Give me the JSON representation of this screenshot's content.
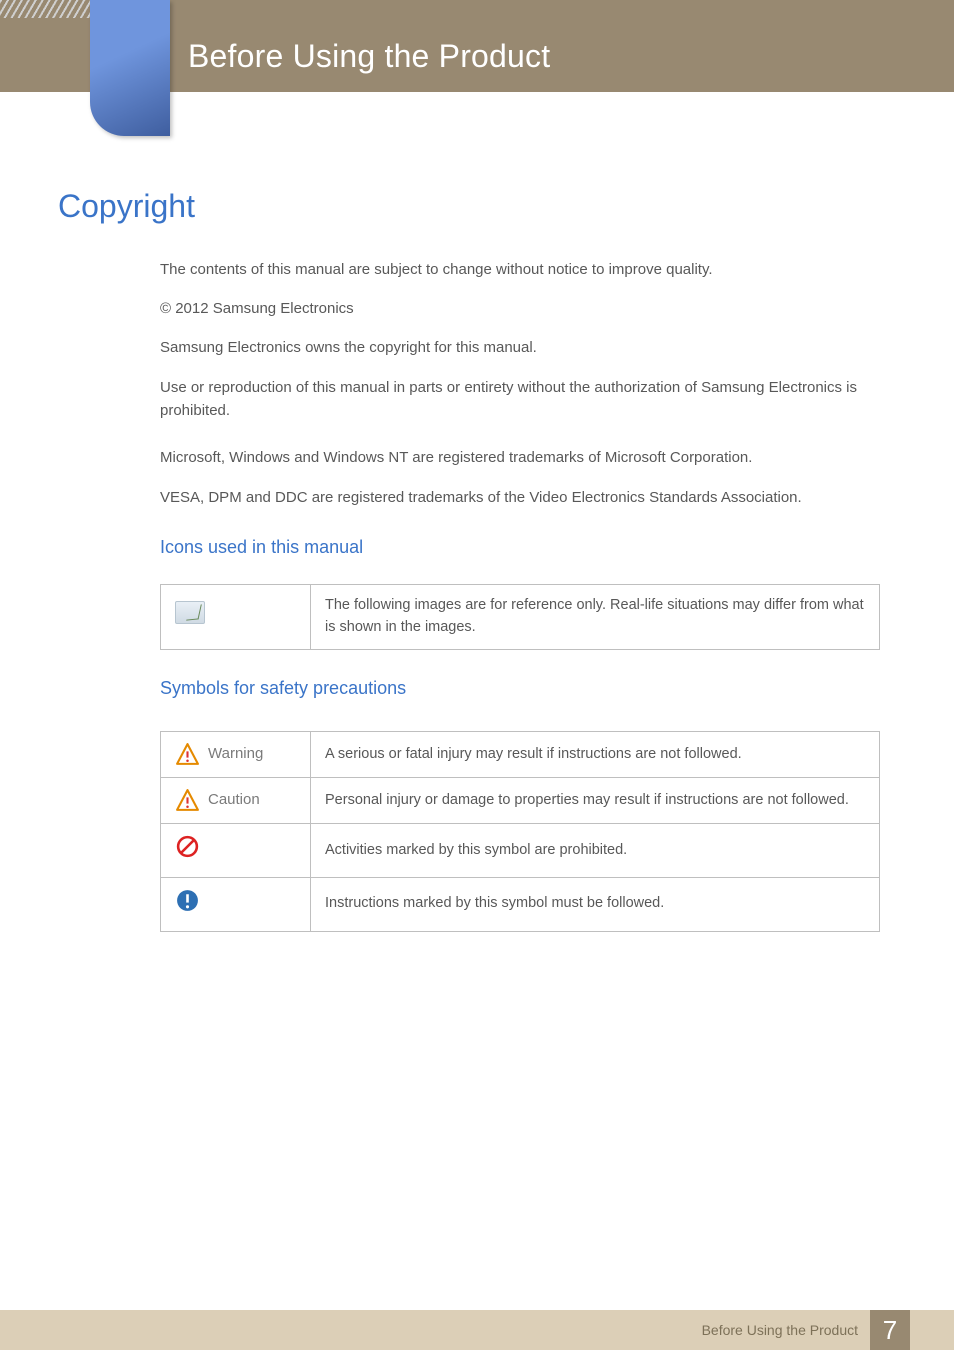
{
  "header": {
    "title": "Before Using the Product"
  },
  "sections": {
    "copyright_heading": "Copyright",
    "paragraphs": {
      "p1": "The contents of this manual are subject to change without notice to improve quality.",
      "p2": "© 2012 Samsung Electronics",
      "p3": "Samsung Electronics owns the copyright for this manual.",
      "p4": "Use or reproduction of this manual in parts or entirety without the authorization of Samsung Electronics is prohibited.",
      "p5": "Microsoft, Windows and Windows NT are registered trademarks of Microsoft Corporation.",
      "p6": "VESA, DPM and DDC are registered trademarks of the Video Electronics Standards Association."
    },
    "icons_heading": "Icons used in this manual",
    "icons_table": {
      "row1_desc": "The following images are for reference only. Real-life situations may differ from what is shown in the images."
    },
    "symbols_heading": "Symbols for safety precautions",
    "symbols_table": {
      "warning_label": "Warning",
      "warning_desc": "A serious or fatal injury may result if instructions are not followed.",
      "caution_label": "Caution",
      "caution_desc": "Personal injury or damage to properties may result if instructions are not followed.",
      "prohibited_desc": "Activities marked by this symbol are prohibited.",
      "mustfollow_desc": "Instructions marked by this symbol must be followed."
    }
  },
  "footer": {
    "text": "Before Using the Product",
    "page": "7"
  }
}
